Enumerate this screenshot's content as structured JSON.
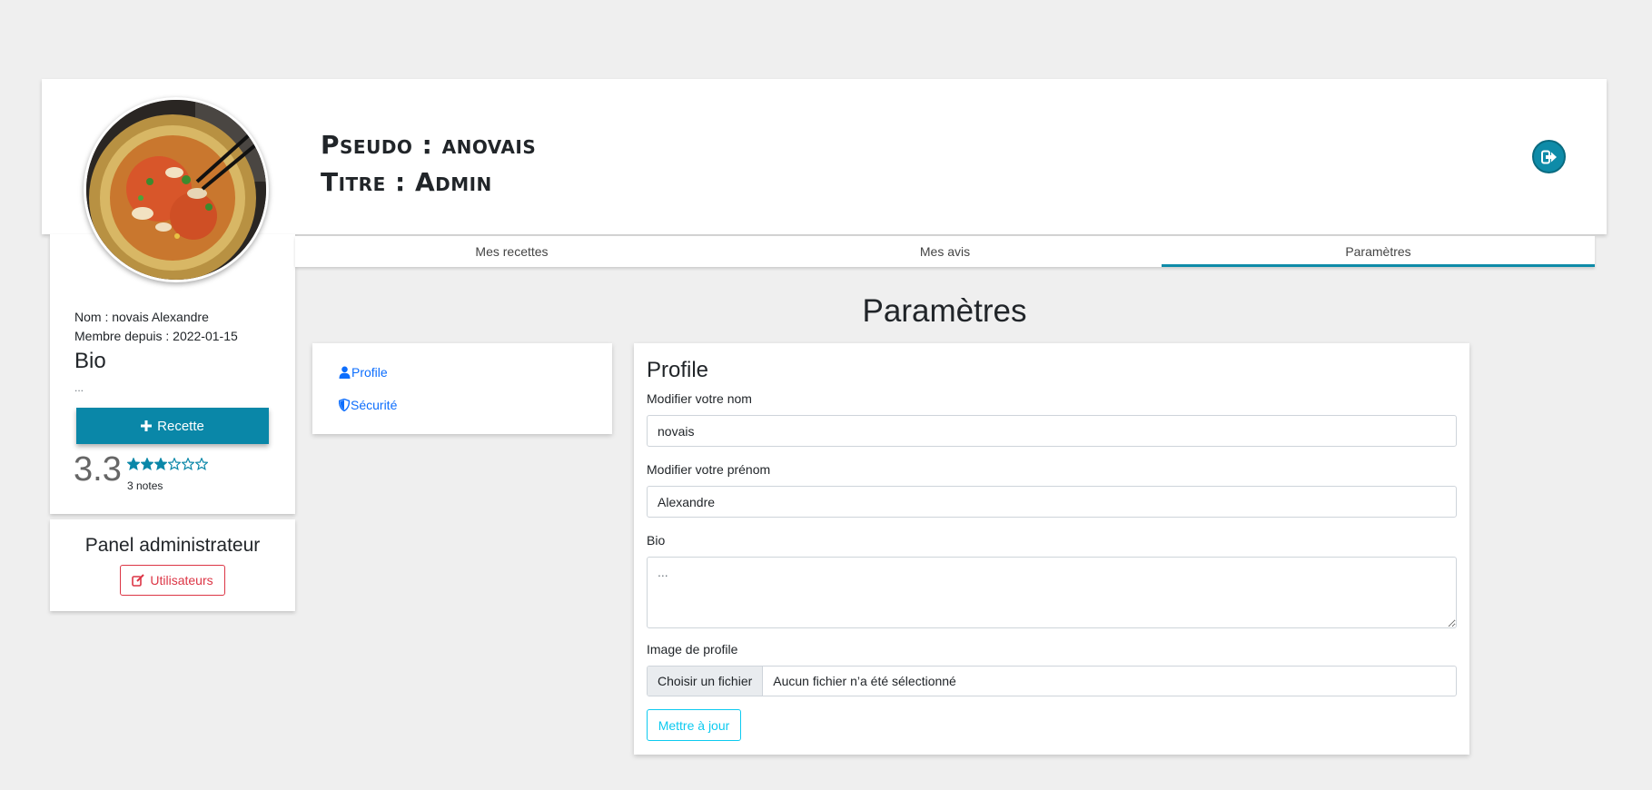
{
  "header": {
    "pseudo": "Pseudo : anovais",
    "titre": "Titre : Admin",
    "logout_icon": "sign-out-icon"
  },
  "profile": {
    "avatar_icon": "soup-photo",
    "nom": "Nom : novais Alexandre",
    "membre": "Membre depuis : 2022-01-15",
    "bio_title": "Bio",
    "bio_text": "...",
    "recette_button": "Recette",
    "rating": "3.3",
    "rating_stars_filled": 3,
    "rating_stars_total": 6,
    "rating_count": "3 notes",
    "accent_color": "#0a87a8"
  },
  "admin": {
    "title": "Panel administrateur",
    "users_button": "Utilisateurs",
    "danger_color": "#dc3545"
  },
  "tabs": [
    {
      "label": "Mes recettes",
      "active": false
    },
    {
      "label": "Mes avis",
      "active": false
    },
    {
      "label": "Paramètres",
      "active": true
    }
  ],
  "page_heading": "Paramètres",
  "settings_nav": {
    "profile": "Profile",
    "securite": "Sécurité",
    "link_color": "#0d6efd"
  },
  "form": {
    "title": "Profile",
    "nom_label": "Modifier votre nom",
    "nom_value": "novais",
    "prenom_label": "Modifier votre prénom",
    "prenom_value": "Alexandre",
    "bio_label": "Bio",
    "bio_placeholder": "...",
    "image_label": "Image de profile",
    "file_button": "Choisir un fichier",
    "file_status": "Aucun fichier n’a été sélectionné",
    "submit": "Mettre à jour",
    "info_color": "#0dcaf0"
  }
}
